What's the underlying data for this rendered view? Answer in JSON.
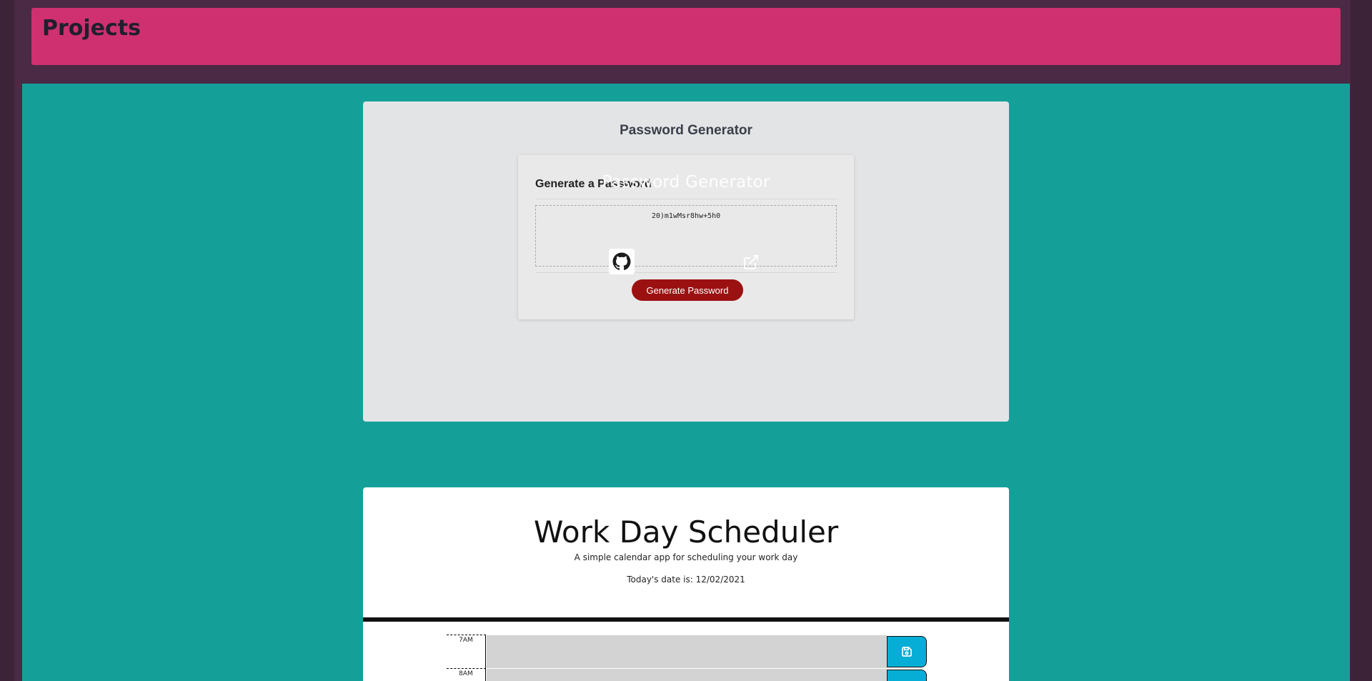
{
  "projects": {
    "title": "Projects"
  },
  "password_generator": {
    "heading": "Password Generator",
    "panel_title": "Generate a Password",
    "generated_password": "20)m1wMsr8hw+5h0",
    "generate_button_label": "Generate Password",
    "overlay_title": "Password Generator"
  },
  "work_day_scheduler": {
    "title": "Work Day Scheduler",
    "subtitle": "A simple calendar app for scheduling your work day",
    "date_text": "Today's date is: 12/02/2021",
    "rows": [
      {
        "hour": "7AM"
      },
      {
        "hour": "8AM"
      }
    ]
  },
  "colors": {
    "frame": "#4a2a44",
    "header_bar": "#cf306f",
    "content_bg": "#14a099",
    "generate_button": "#9b1111",
    "save_button": "#06aed5"
  },
  "icons": {
    "github": "github-icon",
    "external_link": "external-link-icon",
    "save": "save-icon"
  }
}
